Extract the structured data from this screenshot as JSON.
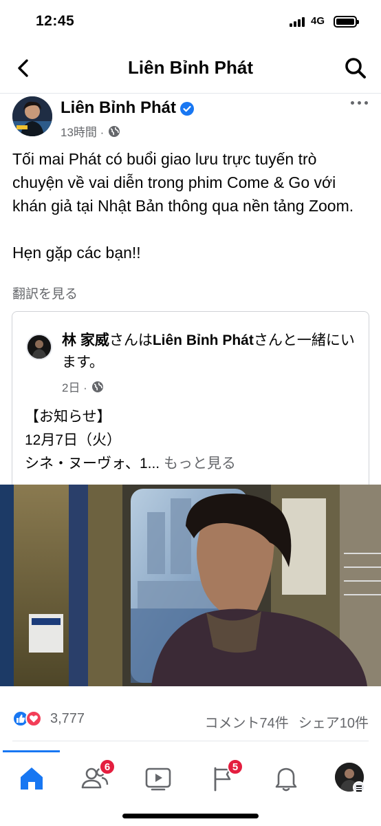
{
  "status_bar": {
    "time": "12:45",
    "network": "4G"
  },
  "header": {
    "title": "Liên Bỉnh Phát",
    "back_icon": "chevron-left-icon",
    "search_icon": "search-icon"
  },
  "post": {
    "author": "Liên Bỉnh Phát",
    "verified": true,
    "time": "13時間 ·",
    "paragraph1": "Tối mai Phát có buổi giao lưu trực tuyến trò chuyện về vai diễn trong phim Come & Go với khán giả tại Nhật Bản thông qua nền tảng Zoom.",
    "paragraph2": "Hẹn gặp các bạn!!",
    "translate_label": "翻訳を見る"
  },
  "shared_post": {
    "author": "林 家威",
    "with_prefix": "さんは",
    "tagged": "Liên Bỉnh Phát",
    "with_suffix": "さんと一緒にいます。",
    "time": "2日 ·",
    "line1": "【お知らせ】",
    "line2": "12月7日（火）",
    "line3": "シネ・ヌーヴォ、1...",
    "see_more": "もっと見る"
  },
  "reactions": {
    "count": "3,777",
    "comments": "コメント74件",
    "shares": "シェア10件"
  },
  "tab_bar": {
    "friends_badge": "6",
    "flag_badge": "5",
    "colors": {
      "accent": "#1877f2",
      "badge": "#e41e3f"
    }
  }
}
